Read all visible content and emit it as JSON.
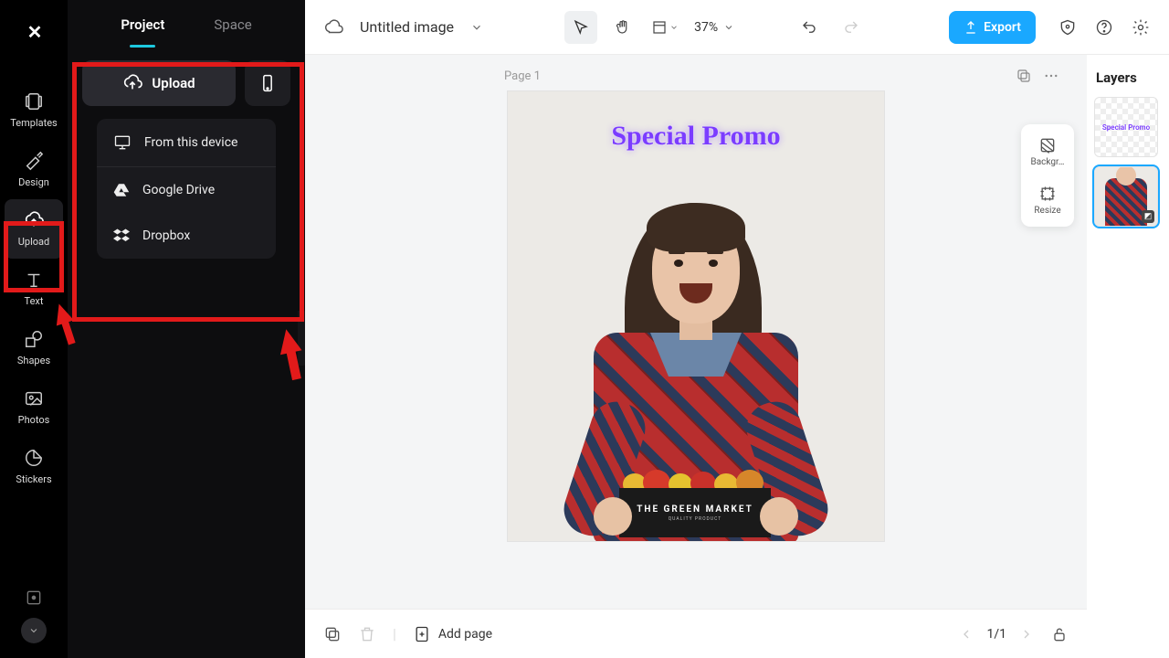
{
  "rail": {
    "templates": "Templates",
    "design": "Design",
    "upload": "Upload",
    "text": "Text",
    "shapes": "Shapes",
    "photos": "Photos",
    "stickers": "Stickers"
  },
  "panel": {
    "tab_project": "Project",
    "tab_space": "Space",
    "upload_btn": "Upload",
    "menu_device": "From this device",
    "menu_gdrive": "Google Drive",
    "menu_dropbox": "Dropbox"
  },
  "topbar": {
    "title": "Untitled image",
    "zoom": "37%",
    "export": "Export"
  },
  "page": {
    "label": "Page 1"
  },
  "canvas": {
    "promo": "Special Promo",
    "crate": "THE GREEN MARKET",
    "crate_sub": "QUALITY PRODUCT"
  },
  "float": {
    "background": "Backgr…",
    "resize": "Resize"
  },
  "layers": {
    "title": "Layers",
    "thumb1_text": "Special Promo"
  },
  "bottom": {
    "add_page": "Add page",
    "pager": "1/1"
  }
}
